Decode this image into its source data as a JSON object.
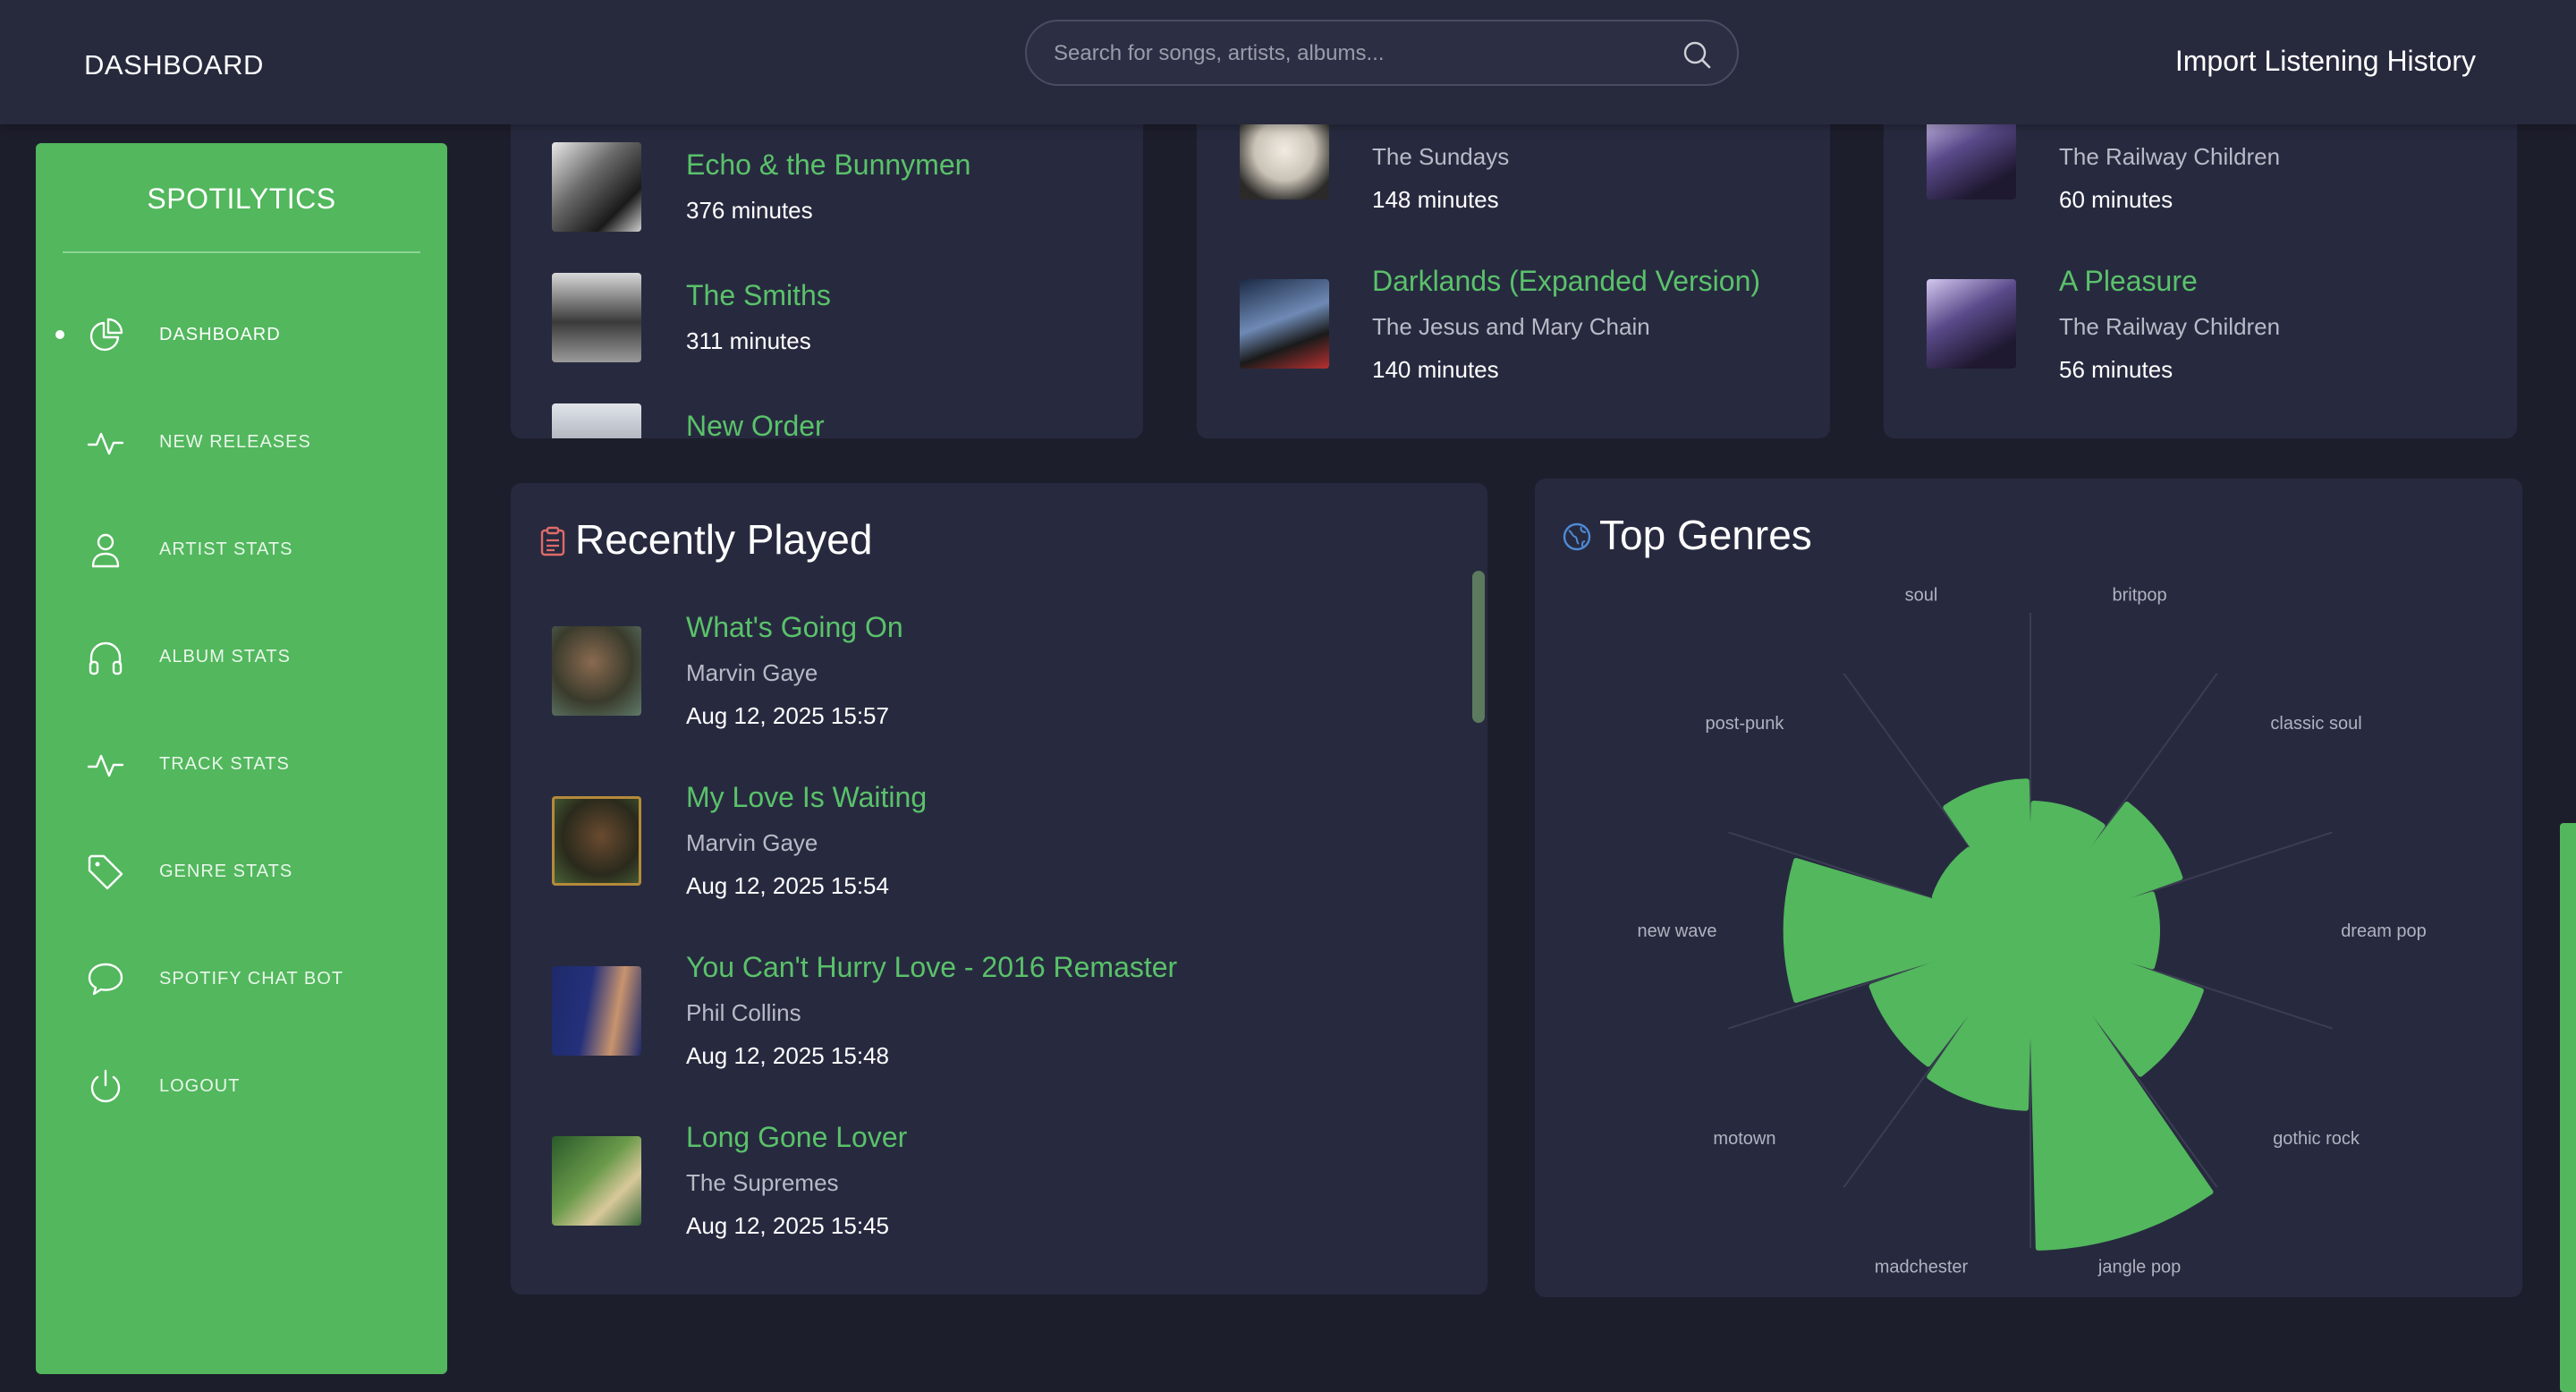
{
  "header": {
    "title": "DASHBOARD",
    "search_placeholder": "Search for songs, artists, albums...",
    "import_label": "Import Listening History"
  },
  "sidebar": {
    "logo": "SPOTILYTICS",
    "items": [
      {
        "label": "DASHBOARD",
        "icon": "pie-chart-icon",
        "active": true
      },
      {
        "label": "NEW RELEASES",
        "icon": "activity-icon"
      },
      {
        "label": "ARTIST STATS",
        "icon": "user-icon"
      },
      {
        "label": "ALBUM STATS",
        "icon": "headphones-icon"
      },
      {
        "label": "TRACK STATS",
        "icon": "activity-icon"
      },
      {
        "label": "GENRE STATS",
        "icon": "tag-icon"
      },
      {
        "label": "SPOTIFY CHAT BOT",
        "icon": "chat-icon"
      },
      {
        "label": "LOGOUT",
        "icon": "power-icon"
      }
    ]
  },
  "top_artists": {
    "items": [
      {
        "name": "Echo & the Bunnymen",
        "minutes": "376 minutes"
      },
      {
        "name": "The Smiths",
        "minutes": "311 minutes"
      },
      {
        "name": "New Order"
      }
    ]
  },
  "top_albums": {
    "items": [
      {
        "artist": "The Sundays",
        "minutes": "148 minutes"
      },
      {
        "name": "Darklands (Expanded Version)",
        "artist": "The Jesus and Mary Chain",
        "minutes": "140 minutes"
      }
    ]
  },
  "top_tracks": {
    "items": [
      {
        "artist": "The Railway Children",
        "minutes": "60 minutes"
      },
      {
        "name": "A Pleasure",
        "artist": "The Railway Children",
        "minutes": "56 minutes"
      }
    ]
  },
  "recently_played": {
    "title": "Recently Played",
    "items": [
      {
        "track": "What's Going On",
        "artist": "Marvin Gaye",
        "time": "Aug 12, 2025 15:57"
      },
      {
        "track": "My Love Is Waiting",
        "artist": "Marvin Gaye",
        "time": "Aug 12, 2025 15:54"
      },
      {
        "track": "You Can't Hurry Love - 2016 Remaster",
        "artist": "Phil Collins",
        "time": "Aug 12, 2025 15:48"
      },
      {
        "track": "Long Gone Lover",
        "artist": "The Supremes",
        "time": "Aug 12, 2025 15:45"
      }
    ]
  },
  "top_genres": {
    "title": "Top Genres"
  },
  "chart_data": {
    "type": "polar-area",
    "categories": [
      "britpop",
      "classic soul",
      "dream pop",
      "gothic rock",
      "jangle pop",
      "madchester",
      "motown",
      "new wave",
      "post-punk",
      "soul"
    ],
    "values": [
      0.4,
      0.5,
      0.4,
      0.57,
      1.0,
      0.56,
      0.53,
      0.77,
      0.32,
      0.47
    ],
    "color": "#52b75d",
    "grid": true,
    "legend": "none"
  },
  "colors": {
    "accent": "#52b75d",
    "background": "#1d1e2c",
    "card": "#272a3f"
  }
}
